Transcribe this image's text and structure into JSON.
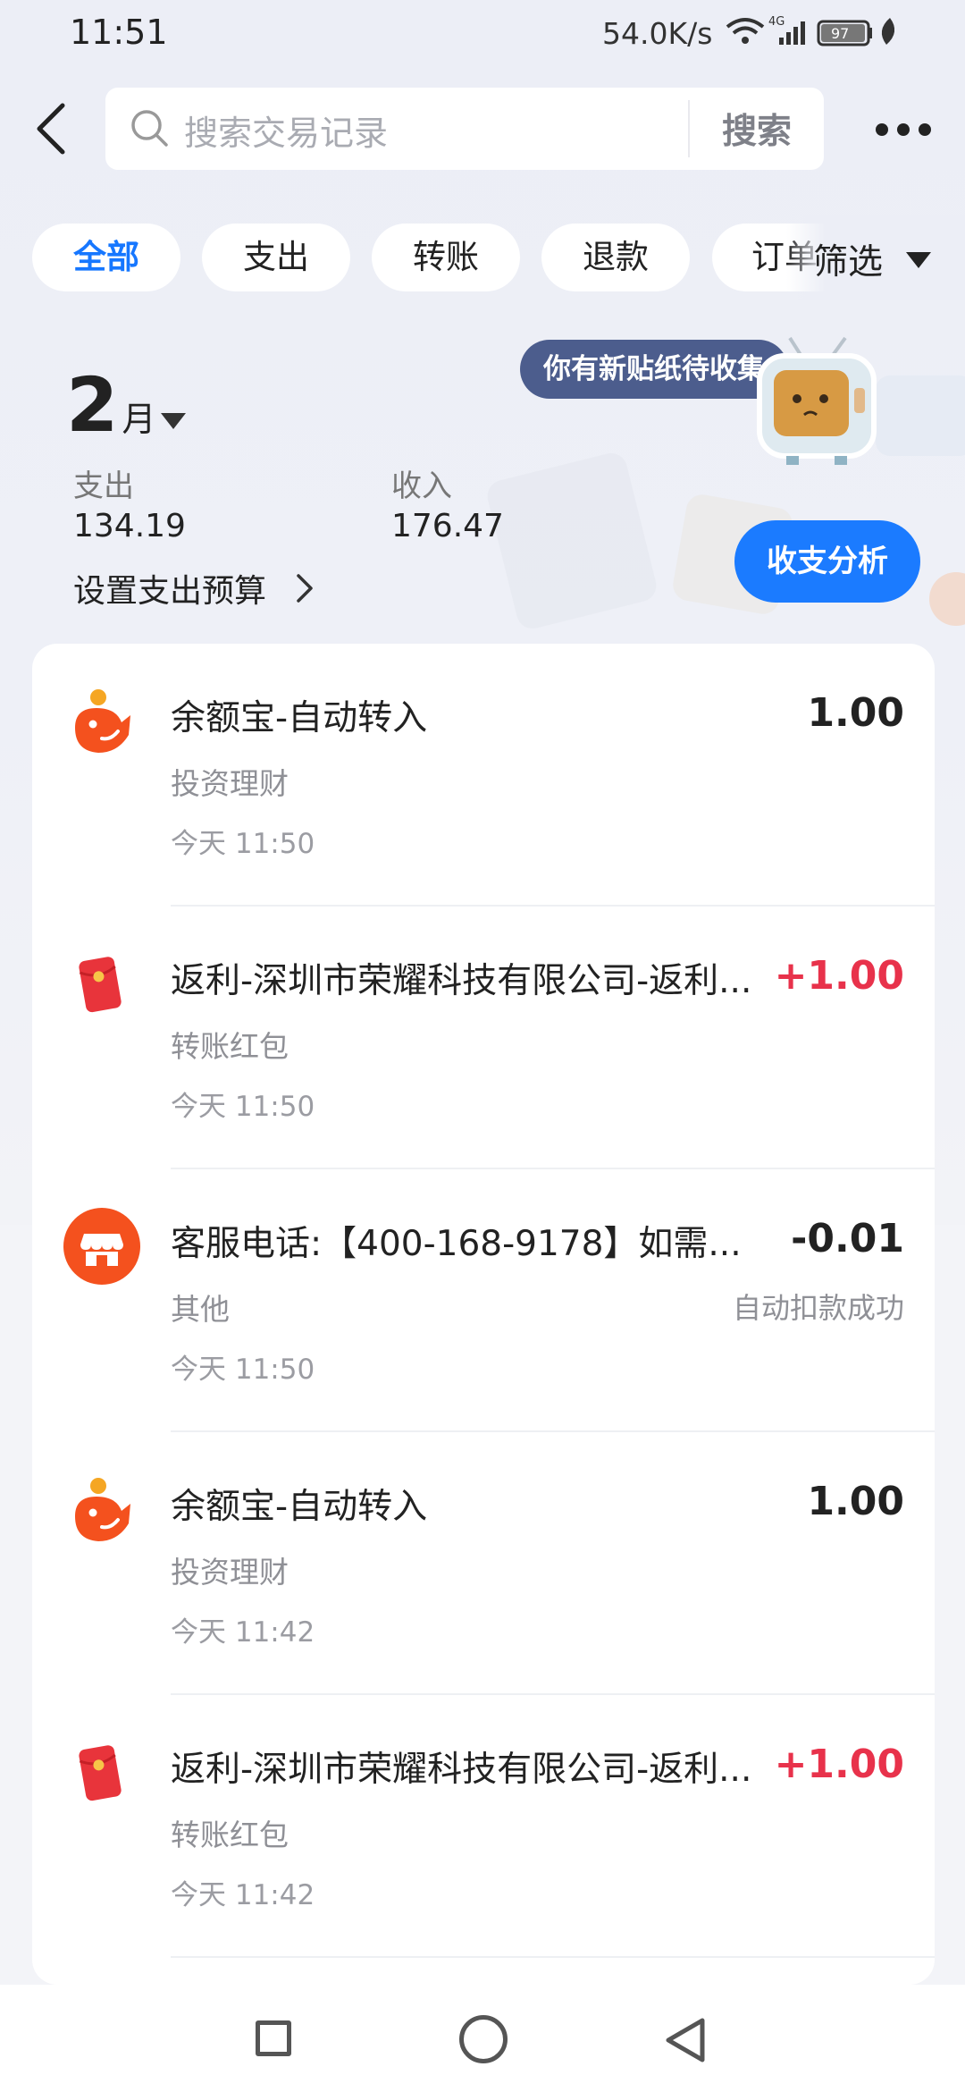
{
  "status_bar": {
    "time": "11:51",
    "net_speed": "54.0K/s",
    "battery": "97",
    "network": "4G"
  },
  "header": {
    "search_placeholder": "搜索交易记录",
    "search_button": "搜索"
  },
  "tabs": [
    {
      "label": "全部",
      "active": true
    },
    {
      "label": "支出",
      "active": false
    },
    {
      "label": "转账",
      "active": false
    },
    {
      "label": "退款",
      "active": false
    },
    {
      "label": "订单",
      "active": false
    }
  ],
  "filter_label": "筛选",
  "summary": {
    "month": "2",
    "month_unit": "月",
    "expense_label": "支出",
    "expense_value": "134.19",
    "income_label": "收入",
    "income_value": "176.47",
    "budget_link": "设置支出预算",
    "sticker_bubble": "你有新贴纸待收集",
    "analysis_button": "收支分析"
  },
  "transactions": [
    {
      "title": "余额宝-自动转入",
      "category": "投资理财",
      "time": "今天 11:50",
      "amount": "1.00",
      "status": "",
      "icon": "yuebao-icon"
    },
    {
      "title": "返利-深圳市荣耀科技有限公司-返利...",
      "category": "转账红包",
      "time": "今天 11:50",
      "amount": "+1.00",
      "status": "",
      "icon": "red-envelope-icon"
    },
    {
      "title": "客服电话:【400-168-9178】如需...",
      "category": "其他",
      "time": "今天 11:50",
      "amount": "-0.01",
      "status": "自动扣款成功",
      "icon": "store-icon"
    },
    {
      "title": "余额宝-自动转入",
      "category": "投资理财",
      "time": "今天 11:42",
      "amount": "1.00",
      "status": "",
      "icon": "yuebao-icon"
    },
    {
      "title": "返利-深圳市荣耀科技有限公司-返利...",
      "category": "转账红包",
      "time": "今天 11:42",
      "amount": "+1.00",
      "status": "",
      "icon": "red-envelope-icon"
    }
  ],
  "colors": {
    "accent": "#1677ff",
    "income_red": "#e8324b",
    "yuebao_orange": "#f4511e"
  }
}
